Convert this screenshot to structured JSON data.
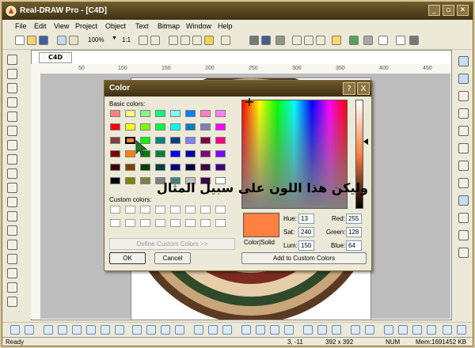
{
  "app": {
    "title": "Real-DRAW Pro - [C4D]"
  },
  "menu": [
    "File",
    "Edit",
    "View",
    "Project",
    "Object",
    "Text",
    "Bitmap",
    "Window",
    "Help"
  ],
  "toolbar": {
    "zoom": "100%",
    "ratio": "1:1"
  },
  "document": {
    "tab": "C4D",
    "rulers": [
      "50",
      "100",
      "150",
      "200",
      "250",
      "300",
      "350",
      "400",
      "450"
    ]
  },
  "dialog": {
    "title": "Color",
    "basic_label": "Basic colors:",
    "custom_label": "Custom colors:",
    "define_button": "Define Custom Colors >>",
    "ok_button": "OK",
    "cancel_button": "Cancel",
    "preview_label": "Color|Solid",
    "add_button": "Add to Custom Colors",
    "hue_label": "Hue:",
    "hue": "13",
    "sat_label": "Sat:",
    "sat": "240",
    "lum_label": "Lum:",
    "lum": "150",
    "red_label": "Red:",
    "red": "255",
    "green_label": "Green:",
    "green": "128",
    "blue_label": "Blue:",
    "blue": "64",
    "help_symbol": "?",
    "close_symbol": "X",
    "basic_colors": [
      "#ff8080",
      "#ffff80",
      "#80ff80",
      "#00ff80",
      "#80ffff",
      "#0080ff",
      "#ff80c0",
      "#ff80ff",
      "#ff0000",
      "#ffff00",
      "#80ff00",
      "#00ff40",
      "#00ffff",
      "#0080c0",
      "#8080c0",
      "#ff00ff",
      "#804040",
      "#ff8040",
      "#00ff00",
      "#008080",
      "#004080",
      "#8080ff",
      "#800040",
      "#ff0080",
      "#800000",
      "#ff8000",
      "#008000",
      "#008040",
      "#0000ff",
      "#0000a0",
      "#800080",
      "#8000ff",
      "#400000",
      "#804000",
      "#004000",
      "#004040",
      "#000080",
      "#000040",
      "#400040",
      "#400080",
      "#000000",
      "#808000",
      "#808040",
      "#808080",
      "#408080",
      "#c0c0c0",
      "#400040",
      "#ffffff"
    ],
    "selected_color": "#ff8040"
  },
  "overlay_text": "وليكن هذا اللون على سبيل المثال",
  "status": {
    "left": "Ready",
    "coords": "3, -11",
    "size": "392 x 392",
    "num": "NUM",
    "mem": "Mem:1691452 KB"
  },
  "colors": {
    "title_dark": "#3f3216",
    "accent": "#ff8040",
    "frame": "#d7c59a"
  }
}
